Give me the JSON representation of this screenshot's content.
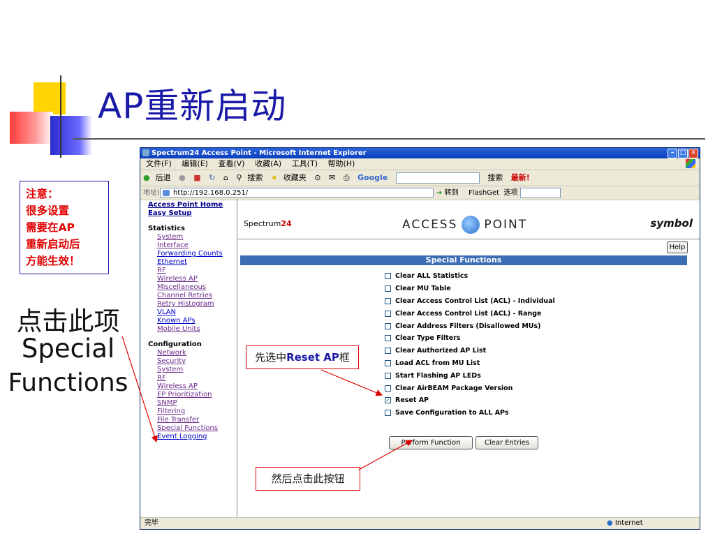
{
  "slide": {
    "title": "AP重新启动",
    "note_lines": [
      "注意：",
      "很多设置",
      "需要在AP",
      "重新启动后",
      "方能生效！"
    ],
    "caption_lines": [
      "点击此项",
      "Special",
      "Functions"
    ],
    "callout1_prefix": "先选中",
    "callout1_bold": "Reset AP",
    "callout1_suffix": "框",
    "callout2": "然后点击此按钮"
  },
  "window": {
    "title": "Spectrum24 Access Point - Microsoft Internet Explorer",
    "menu": [
      "文件(F)",
      "编辑(E)",
      "查看(V)",
      "收藏(A)",
      "工具(T)",
      "帮助(H)"
    ],
    "toolbar": [
      "后退",
      "搜索",
      "收藏夹",
      "Google",
      "搜索",
      "最新!"
    ],
    "address_label": "地址(D)",
    "address": "http://192.168.0.251/",
    "go_label": "转到",
    "flashget": "FlashGet",
    "options_label": "选项",
    "status_text": "完毕",
    "status_zone": "Internet"
  },
  "nav": {
    "home": "Access Point Home",
    "easy_setup": "Easy Setup",
    "statistics_label": "Statistics",
    "statistics": [
      "System",
      "Interface",
      "Forwarding Counts",
      "Ethernet",
      "RF",
      "Wireless AP",
      "Miscellaneous",
      "Channel Retries",
      "Retry Histogram",
      "VLAN",
      "Known APs",
      "Mobile Units"
    ],
    "configuration_label": "Configuration",
    "configuration": [
      "Network",
      "Security",
      "System",
      "RF",
      "Wireless AP",
      "EP Prioritization",
      "SNMP",
      "Filtering",
      "File Transfer",
      "Special Functions",
      "Event Logging"
    ]
  },
  "page": {
    "brand_left": "Spectrum",
    "brand_left_num": "24",
    "brand_center_1": "ACCESS",
    "brand_center_2": "POINT",
    "brand_right": "symbol",
    "help": "Help",
    "header": "Special Functions",
    "options": [
      {
        "label": "Clear ALL Statistics",
        "checked": false
      },
      {
        "label": "Clear MU Table",
        "checked": false
      },
      {
        "label": "Clear Access Control List (ACL) - Individual",
        "checked": false
      },
      {
        "label": "Clear Access Control List (ACL) - Range",
        "checked": false
      },
      {
        "label": "Clear Address Filters (Disallowed MUs)",
        "checked": false
      },
      {
        "label": "Clear Type Filters",
        "checked": false
      },
      {
        "label": "Clear Authorized AP List",
        "checked": false
      },
      {
        "label": "Load ACL from MU List",
        "checked": false
      },
      {
        "label": "Start Flashing AP LEDs",
        "checked": false
      },
      {
        "label": "Clear AirBEAM Package Version",
        "checked": false
      },
      {
        "label": "Reset AP",
        "checked": true
      },
      {
        "label": "Save Configuration to ALL APs",
        "checked": false
      }
    ],
    "perform_button": "Perform Function",
    "clear_button": "Clear Entries"
  }
}
